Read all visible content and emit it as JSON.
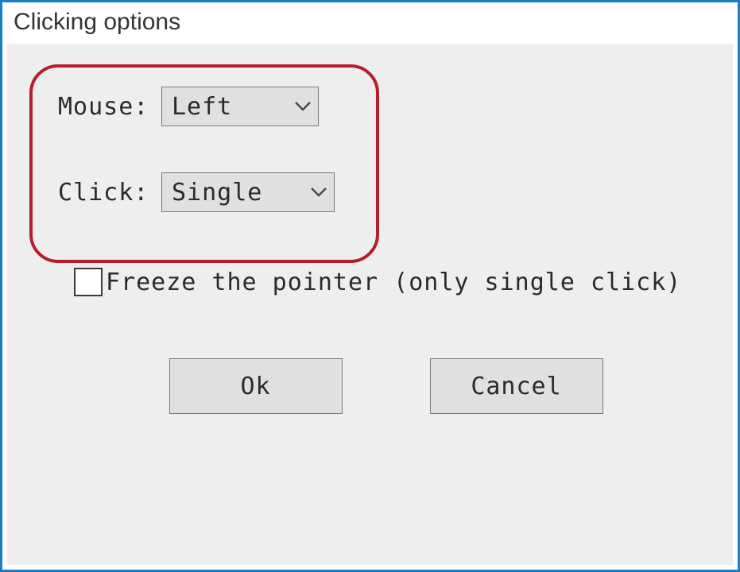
{
  "window": {
    "title": "Clicking options"
  },
  "form": {
    "mouse_label": "Mouse:",
    "mouse_value": "Left",
    "click_label": "Click:",
    "click_value": "Single",
    "freeze_label": "Freeze the pointer (only single click)",
    "freeze_checked": false
  },
  "buttons": {
    "ok": "Ok",
    "cancel": "Cancel"
  }
}
